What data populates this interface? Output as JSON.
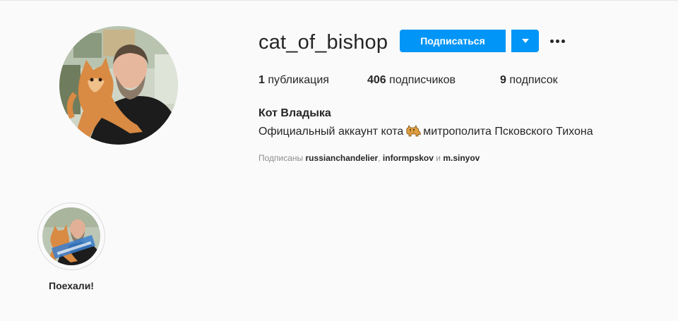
{
  "profile": {
    "username": "cat_of_bishop",
    "follow_label": "Подписаться",
    "dropdown_icon": "chevron-down-icon",
    "more_icon": "more-options-icon",
    "avatar_icon": "profile-photo"
  },
  "stats": {
    "posts_count": "1",
    "posts_label": "публикация",
    "followers_count": "406",
    "followers_label": "подписчиков",
    "following_count": "9",
    "following_label": "подписок"
  },
  "bio": {
    "full_name": "Кот Владыка",
    "text_before": "Официальный аккаунт кота",
    "emoji": "cat-emoji",
    "text_after": "митрополита Псковского Тихона"
  },
  "followed_by": {
    "prefix": "Подписаны",
    "accounts": [
      "russianchandelier",
      "informpskov",
      "m.sinyov"
    ],
    "separator": ",",
    "conjunction": "и"
  },
  "highlights": [
    {
      "label": "Поехали!"
    }
  ],
  "colors": {
    "accent": "#0095f6",
    "background": "#fafafa",
    "text": "#262626",
    "secondary_text": "#8e8e8e"
  }
}
